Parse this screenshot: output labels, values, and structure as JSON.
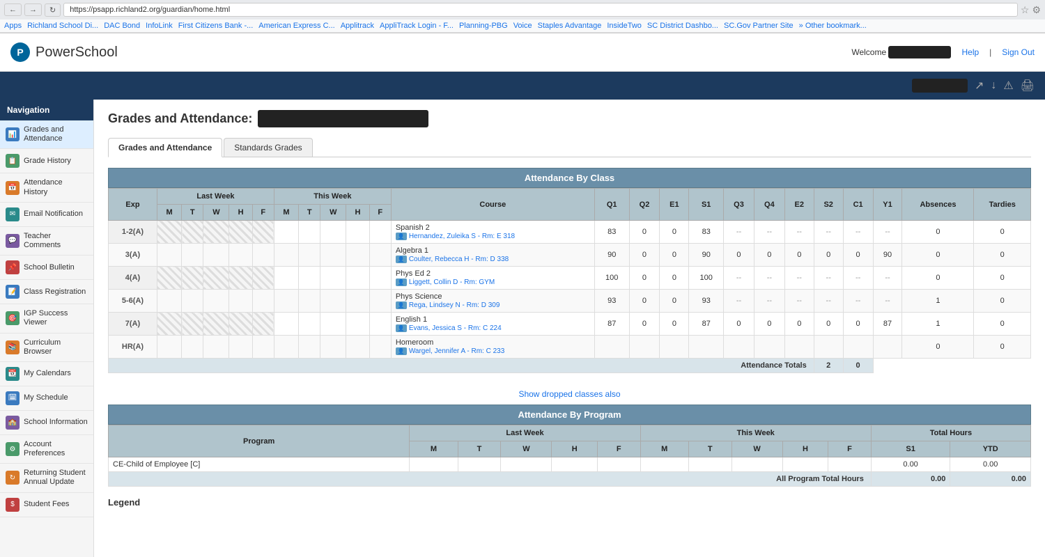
{
  "browser": {
    "url": "https://psapp.richland2.org/guardian/home.html",
    "bookmarks": [
      "Apps",
      "Richland School Di...",
      "DAC Bond",
      "InfoLink",
      "First Citizens Bank -...",
      "American Express C...",
      "Applitrack",
      "AppliTrack Login - F...",
      "Planning-PBG",
      "Voice",
      "Staples Advantage",
      "InsideTwo",
      "SC District Dashbo...",
      "SC.Gov Partner Site",
      "» Other bookmark..."
    ]
  },
  "header": {
    "logo_letter": "P",
    "app_name": "PowerSchool",
    "welcome_label": "Welcome",
    "help_label": "Help",
    "sign_out_label": "Sign Out"
  },
  "sidebar": {
    "nav_label": "Navigation",
    "items": [
      {
        "id": "grades-attendance",
        "label": "Grades and Attendance",
        "icon": "📊",
        "icon_color": "blue2"
      },
      {
        "id": "grade-history",
        "label": "Grade History",
        "icon": "📋",
        "icon_color": "green"
      },
      {
        "id": "attendance-history",
        "label": "Attendance History",
        "icon": "📅",
        "icon_color": "orange"
      },
      {
        "id": "email-notification",
        "label": "Email Notification",
        "icon": "✉",
        "icon_color": "teal"
      },
      {
        "id": "teacher-comments",
        "label": "Teacher Comments",
        "icon": "💬",
        "icon_color": "purple"
      },
      {
        "id": "school-bulletin",
        "label": "School Bulletin",
        "icon": "📌",
        "icon_color": "red"
      },
      {
        "id": "class-registration",
        "label": "Class Registration",
        "icon": "📝",
        "icon_color": "blue2"
      },
      {
        "id": "igp-success-viewer",
        "label": "IGP Success Viewer",
        "icon": "🎯",
        "icon_color": "green"
      },
      {
        "id": "curriculum-browser",
        "label": "Curriculum Browser",
        "icon": "📚",
        "icon_color": "orange"
      },
      {
        "id": "my-calendars",
        "label": "My Calendars",
        "icon": "📆",
        "icon_color": "teal"
      },
      {
        "id": "my-schedule",
        "label": "My Schedule",
        "icon": "🗓",
        "icon_color": "blue2"
      },
      {
        "id": "school-information",
        "label": "School Information",
        "icon": "🏫",
        "icon_color": "purple"
      },
      {
        "id": "account-preferences",
        "label": "Account Preferences",
        "icon": "⚙",
        "icon_color": "green"
      },
      {
        "id": "returning-student",
        "label": "Returning Student Annual Update",
        "icon": "🔄",
        "icon_color": "orange"
      },
      {
        "id": "student-fees",
        "label": "Student Fees",
        "icon": "💲",
        "icon_color": "red"
      }
    ]
  },
  "main": {
    "page_title": "Grades and Attendance:",
    "tabs": [
      {
        "id": "grades-attendance",
        "label": "Grades and Attendance",
        "active": true
      },
      {
        "id": "standards-grades",
        "label": "Standards Grades",
        "active": false
      }
    ],
    "attendance_by_class": {
      "title": "Attendance By Class",
      "col_groups": {
        "exp": "Exp",
        "last_week": "Last Week",
        "this_week": "This Week",
        "course": "Course",
        "q1": "Q1",
        "q2": "Q2",
        "e1": "E1",
        "s1": "S1",
        "q3": "Q3",
        "q4": "Q4",
        "e2": "E2",
        "s2": "S2",
        "c1": "C1",
        "y1": "Y1",
        "absences": "Absences",
        "tardies": "Tardies"
      },
      "day_headers": [
        "M",
        "T",
        "W",
        "H",
        "F"
      ],
      "rows": [
        {
          "exp": "1-2(A)",
          "course_name": "Spanish 2",
          "teacher": "Hernandez, Zuleika S - Rm: E 318",
          "q1": "83",
          "q2": "0",
          "e1": "0",
          "s1": "83",
          "q3": "--",
          "q4": "--",
          "e2": "--",
          "s2": "--",
          "c1": "--",
          "y1": "--",
          "absences": "0",
          "tardies": "0"
        },
        {
          "exp": "3(A)",
          "course_name": "Algebra 1",
          "teacher": "Coulter, Rebecca H - Rm: D 338",
          "q1": "90",
          "q2": "0",
          "e1": "0",
          "s1": "90",
          "q3": "0",
          "q4": "0",
          "e2": "0",
          "s2": "0",
          "c1": "0",
          "y1": "90",
          "absences": "0",
          "tardies": "0"
        },
        {
          "exp": "4(A)",
          "course_name": "Phys Ed 2",
          "teacher": "Liggett, Collin D - Rm: GYM",
          "q1": "100",
          "q2": "0",
          "e1": "0",
          "s1": "100",
          "q3": "--",
          "q4": "--",
          "e2": "--",
          "s2": "--",
          "c1": "--",
          "y1": "--",
          "absences": "0",
          "tardies": "0"
        },
        {
          "exp": "5-6(A)",
          "course_name": "Phys Science",
          "teacher": "Rega, Lindsey N - Rm: D 309",
          "q1": "93",
          "q2": "0",
          "e1": "0",
          "s1": "93",
          "q3": "--",
          "q4": "--",
          "e2": "--",
          "s2": "--",
          "c1": "--",
          "y1": "--",
          "absences": "1",
          "tardies": "0"
        },
        {
          "exp": "7(A)",
          "course_name": "English 1",
          "teacher": "Evans, Jessica S - Rm: C 224",
          "q1": "87",
          "q2": "0",
          "e1": "0",
          "s1": "87",
          "q3": "0",
          "q4": "0",
          "e2": "0",
          "s2": "0",
          "c1": "0",
          "y1": "87",
          "absences": "1",
          "tardies": "0"
        },
        {
          "exp": "HR(A)",
          "course_name": "Homeroom",
          "teacher": "Wargel, Jennifer A - Rm: C 233",
          "q1": "",
          "q2": "",
          "e1": "",
          "s1": "",
          "q3": "",
          "q4": "",
          "e2": "",
          "s2": "",
          "c1": "",
          "y1": "",
          "absences": "0",
          "tardies": "0"
        }
      ],
      "totals": {
        "label": "Attendance Totals",
        "absences": "2",
        "tardies": "0"
      },
      "show_dropped_label": "Show dropped classes also"
    },
    "attendance_by_program": {
      "title": "Attendance By Program",
      "col_program": "Program",
      "col_last_week": "Last Week",
      "col_this_week": "This Week",
      "col_total_hours": "Total Hours",
      "day_headers_last": [
        "M",
        "T",
        "W",
        "H",
        "F"
      ],
      "day_headers_this": [
        "M",
        "T",
        "W",
        "H",
        "F"
      ],
      "sub_headers": [
        "S1",
        "YTD"
      ],
      "rows": [
        {
          "program": "CE-Child of Employee [C]",
          "s1": "0.00",
          "ytd": "0.00"
        }
      ],
      "totals": {
        "label": "All Program Total Hours",
        "s1": "0.00",
        "ytd": "0.00"
      }
    },
    "legend": {
      "title": "Legend"
    }
  }
}
